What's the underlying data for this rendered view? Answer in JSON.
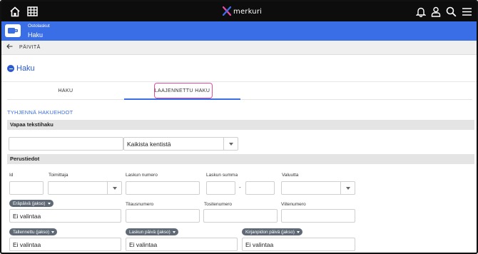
{
  "topbar": {
    "brand": "merkuri",
    "icons": [
      "home-icon",
      "grid-icon",
      "bell-icon",
      "user-icon",
      "search-icon",
      "menu-icon"
    ],
    "brand_color": "#e64a9e",
    "background": "#0d0d0d"
  },
  "module": {
    "subtitle": "Ostolaskut",
    "title": "Haku",
    "background": "#3a6ee6"
  },
  "toolbar": {
    "refresh_label": "PÄIVITÄ"
  },
  "page": {
    "title": "Haku"
  },
  "tabs": [
    {
      "label": "HAKU",
      "active": false
    },
    {
      "label": "LAAJENNETTU HAKU",
      "active": true
    }
  ],
  "clear_label": "TYHJENNÄ HAKUEHDOT",
  "sections": {
    "free_text": "Vapaa tekstihaku",
    "basic": "Perustiedot"
  },
  "free_text": {
    "query_value": "",
    "scope_value": "Kaikista kentistä"
  },
  "fields": {
    "id": "Id",
    "supplier": "Toimittaja",
    "invoice_number": "Laskun numero",
    "invoice_sum": "Laskun summa",
    "currency": "Valuutta",
    "order_number": "Tilausnumero",
    "voucher_number": "Tositenumero",
    "reference_number": "Viitenumero",
    "sum_dash": "-"
  },
  "date_filters": {
    "due_date": {
      "label": "Eräpäivä (jakso)",
      "value": "Ei valintaa"
    },
    "saved": {
      "label": "Tallennettu (jakso)",
      "value": "Ei valintaa"
    },
    "invoice_date": {
      "label": "Laskun päivä (jakso)",
      "value": "Ei valintaa"
    },
    "accounting_date": {
      "label": "Kirjanpidon päivä (jakso)",
      "value": "Ei valintaa"
    }
  }
}
